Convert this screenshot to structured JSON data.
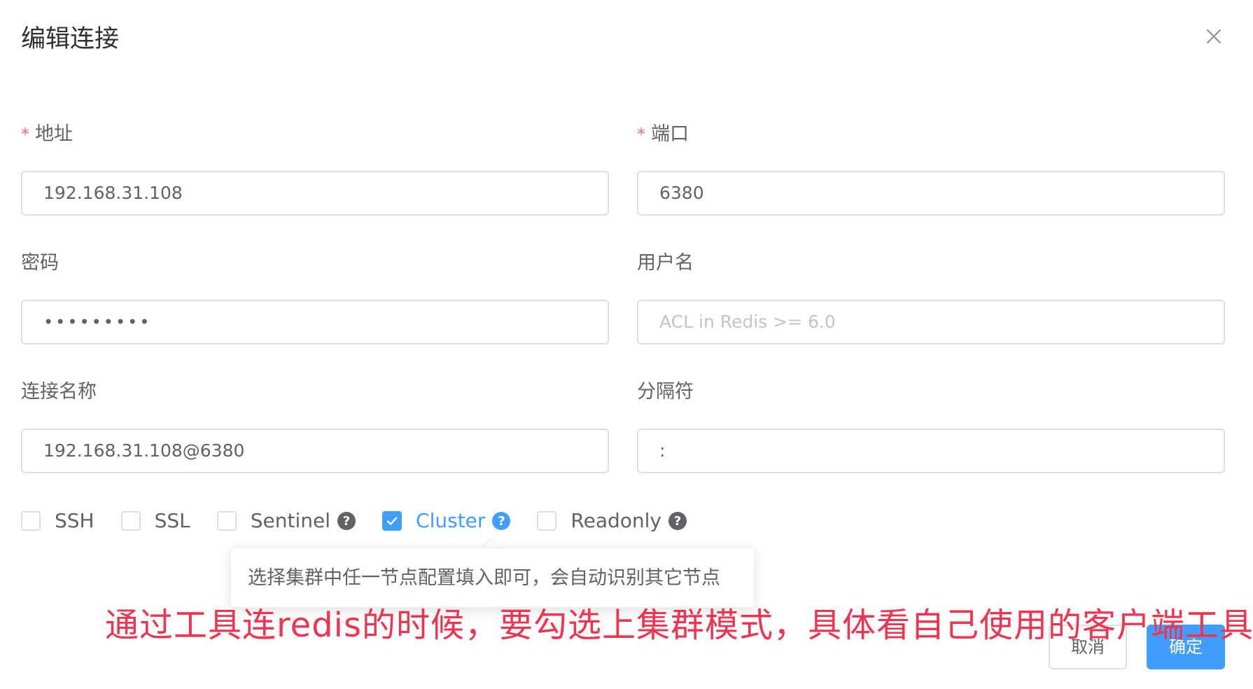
{
  "dialog": {
    "title": "编辑连接"
  },
  "fields": {
    "address": {
      "label": "地址",
      "required_mark": "*",
      "value": "192.168.31.108"
    },
    "port": {
      "label": "端口",
      "required_mark": "*",
      "value": "6380"
    },
    "password": {
      "label": "密码",
      "value": "•••••••••"
    },
    "username": {
      "label": "用户名",
      "placeholder": "ACL in Redis >= 6.0"
    },
    "connection_name": {
      "label": "连接名称",
      "value": "192.168.31.108@6380"
    },
    "separator": {
      "label": "分隔符",
      "value": ":"
    }
  },
  "options": {
    "ssh": {
      "label": "SSH",
      "checked": false
    },
    "ssl": {
      "label": "SSL",
      "checked": false
    },
    "sentinel": {
      "label": "Sentinel",
      "checked": false,
      "help": "?"
    },
    "cluster": {
      "label": "Cluster",
      "checked": true,
      "help": "?"
    },
    "readonly": {
      "label": "Readonly",
      "checked": false,
      "help": "?"
    }
  },
  "tooltip": {
    "text": "选择集群中任一节点配置填入即可，会自动识别其它节点"
  },
  "buttons": {
    "cancel": "取消",
    "ok": "确定"
  },
  "annotation": {
    "text": "通过工具连redis的时候，要勾选上集群模式，具体看自己使用的客户端工具"
  },
  "colors": {
    "primary": "#409eff",
    "required": "#f56c6c",
    "annotation": "#f2334f",
    "border": "#dcdfe6"
  }
}
